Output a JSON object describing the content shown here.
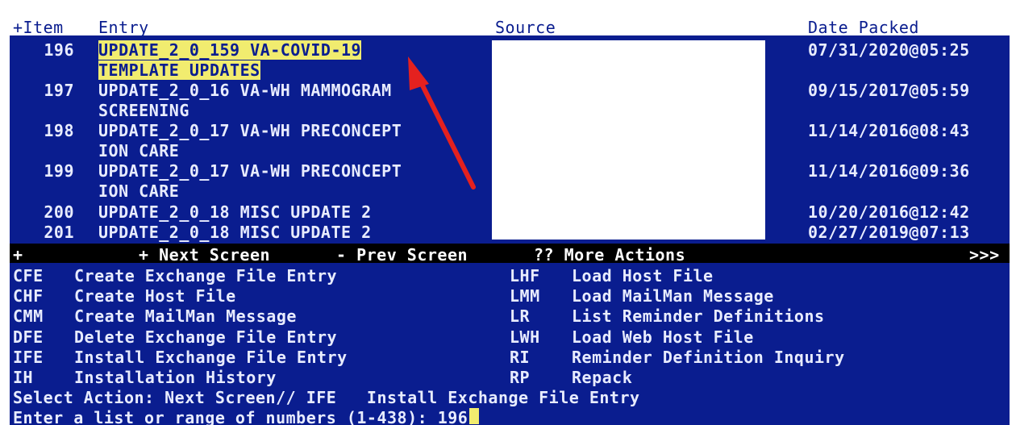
{
  "header": {
    "item": "+Item",
    "entry": "Entry",
    "source": "Source",
    "date_packed": "Date Packed"
  },
  "rows": [
    {
      "num": "196",
      "line1": "UPDATE_2_0_159 VA-COVID-19",
      "line2": "TEMPLATE UPDATES",
      "date": "07/31/2020@05:25",
      "highlighted": true
    },
    {
      "num": "197",
      "line1": "UPDATE_2_0_16 VA-WH MAMMOGRAM",
      "line2": "SCREENING",
      "date": "09/15/2017@05:59"
    },
    {
      "num": "198",
      "line1": "UPDATE_2_0_17 VA-WH PRECONCEPT",
      "line2": "ION CARE",
      "date": "11/14/2016@08:43"
    },
    {
      "num": "199",
      "line1": "UPDATE_2_0_17 VA-WH PRECONCEPT",
      "line2": "ION CARE",
      "date": "11/14/2016@09:36"
    },
    {
      "num": "200",
      "line1": "UPDATE_2_0_18 MISC UPDATE 2",
      "date": "10/20/2016@12:42"
    },
    {
      "num": "201",
      "line1": "UPDATE_2_0_18 MISC UPDATE 2",
      "date": "02/27/2019@07:13"
    }
  ],
  "nav": {
    "plus": "+",
    "next": "+ Next Screen",
    "prev": "- Prev Screen",
    "more": "?? More Actions",
    "more_arrow": ">>>"
  },
  "actions_left": [
    {
      "code": "CFE",
      "label": "Create Exchange File Entry"
    },
    {
      "code": "CHF",
      "label": "Create Host File"
    },
    {
      "code": "CMM",
      "label": "Create MailMan Message"
    },
    {
      "code": "DFE",
      "label": "Delete Exchange File Entry"
    },
    {
      "code": "IFE",
      "label": "Install Exchange File Entry"
    },
    {
      "code": "IH",
      "label": "Installation History"
    }
  ],
  "actions_right": [
    {
      "code": "LHF",
      "label": "Load Host File"
    },
    {
      "code": "LMM",
      "label": "Load MailMan Message"
    },
    {
      "code": "LR",
      "label": "List Reminder Definitions"
    },
    {
      "code": "LWH",
      "label": "Load Web Host File"
    },
    {
      "code": "RI",
      "label": "Reminder Definition Inquiry"
    },
    {
      "code": "RP",
      "label": "Repack"
    }
  ],
  "prompt": {
    "select_action": "Select Action: Next Screen// IFE   Install Exchange File Entry",
    "enter_range": "Enter a list or range of numbers (1-438): 196"
  },
  "colors": {
    "terminal_bg": "#0a1d8f",
    "highlight": "#f1ec6f",
    "arrow": "#e4211f"
  },
  "annotation": "red-arrow-icon"
}
